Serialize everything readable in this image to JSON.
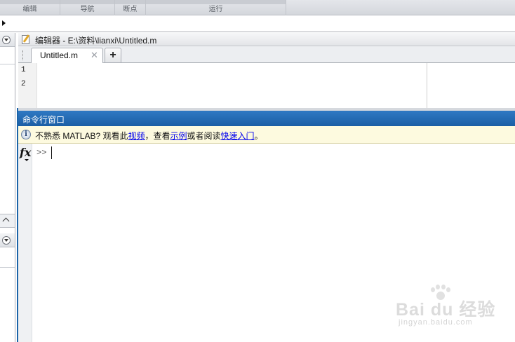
{
  "ribbon": {
    "groups": [
      "编辑",
      "导航",
      "断点",
      "运行"
    ]
  },
  "editor": {
    "title": "编辑器 - E:\\资料\\lianxi\\Untitled.m",
    "tab_label": "Untitled.m",
    "tab_close": "✕",
    "add_tab": "+",
    "line_numbers": [
      "1",
      "2"
    ]
  },
  "command_window": {
    "title": "命令行窗口",
    "info": {
      "prefix": "不熟悉 MATLAB? 观看此",
      "link_video": "视频",
      "middle": "，查看",
      "link_examples": "示例",
      "middle2": "或者阅读",
      "link_getting_started": "快速入门",
      "suffix": "。"
    },
    "fx_label": "fx",
    "prompt": ">>"
  },
  "watermark": {
    "text": "Bai du 经验",
    "sub": "jingyan.baidu.com"
  },
  "colors": {
    "command_title_bg": "#1b5ea5",
    "info_bar_bg": "#fdfadf",
    "link": "#0000ee"
  }
}
